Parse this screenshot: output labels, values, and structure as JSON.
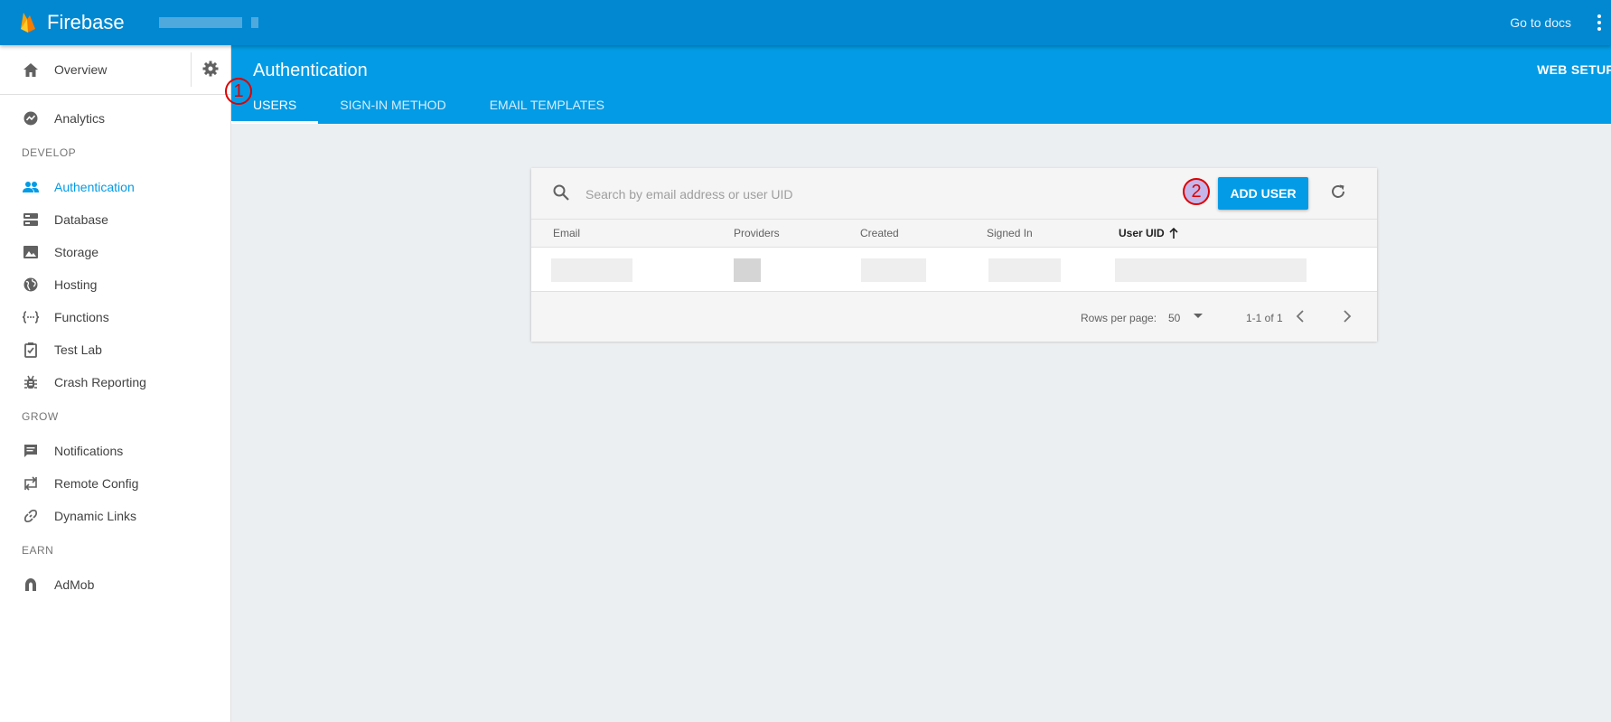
{
  "topbar": {
    "brand": "Firebase",
    "goto_docs": "Go to docs"
  },
  "sidebar": {
    "overview": "Overview",
    "analytics": "Analytics",
    "sections": {
      "develop": "DEVELOP",
      "grow": "GROW",
      "earn": "EARN"
    },
    "develop_items": [
      {
        "label": "Authentication",
        "icon": "people-icon"
      },
      {
        "label": "Database",
        "icon": "database-icon"
      },
      {
        "label": "Storage",
        "icon": "image-icon"
      },
      {
        "label": "Hosting",
        "icon": "globe-icon"
      },
      {
        "label": "Functions",
        "icon": "functions-icon"
      },
      {
        "label": "Test Lab",
        "icon": "checklist-icon"
      },
      {
        "label": "Crash Reporting",
        "icon": "bug-icon"
      }
    ],
    "grow_items": [
      {
        "label": "Notifications",
        "icon": "message-icon"
      },
      {
        "label": "Remote Config",
        "icon": "remote-config-icon"
      },
      {
        "label": "Dynamic Links",
        "icon": "link-icon"
      }
    ],
    "earn_items": [
      {
        "label": "AdMob",
        "icon": "admob-icon"
      }
    ]
  },
  "header": {
    "title": "Authentication",
    "web_setup": "WEB SETUP",
    "tabs": [
      {
        "label": "USERS"
      },
      {
        "label": "SIGN-IN METHOD"
      },
      {
        "label": "EMAIL TEMPLATES"
      }
    ]
  },
  "markers": {
    "m1": "1",
    "m2": "2"
  },
  "users_card": {
    "search_placeholder": "Search by email address or user UID",
    "add_user": "ADD USER",
    "columns": {
      "email": "Email",
      "providers": "Providers",
      "created": "Created",
      "signed_in": "Signed In",
      "uid": "User UID"
    },
    "footer": {
      "rows_per_page_label": "Rows per page:",
      "rows_per_page_value": "50",
      "range": "1-1 of 1"
    }
  },
  "colors": {
    "topbar": "#0288d1",
    "header": "#039be5",
    "accent": "#039be5",
    "marker": "#dd0000"
  }
}
